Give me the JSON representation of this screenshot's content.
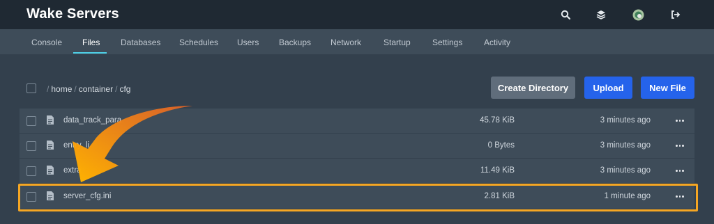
{
  "app": {
    "title": "Wake Servers"
  },
  "topbar": {
    "icons": [
      "search-icon",
      "layers-icon",
      "avatar",
      "logout-icon"
    ]
  },
  "nav": {
    "tabs": [
      {
        "label": "Console"
      },
      {
        "label": "Files"
      },
      {
        "label": "Databases"
      },
      {
        "label": "Schedules"
      },
      {
        "label": "Users"
      },
      {
        "label": "Backups"
      },
      {
        "label": "Network"
      },
      {
        "label": "Startup"
      },
      {
        "label": "Settings"
      },
      {
        "label": "Activity"
      }
    ],
    "active_tab": "Files"
  },
  "breadcrumb": {
    "root": "/",
    "segments": [
      "home",
      "container",
      "cfg"
    ],
    "separator": "/"
  },
  "actions": {
    "create_directory": "Create Directory",
    "upload": "Upload",
    "new_file": "New File"
  },
  "files": [
    {
      "name": "data_track_para",
      "size": "45.78 KiB",
      "modified": "3 minutes ago"
    },
    {
      "name": "entry_li",
      "size": "0 Bytes",
      "modified": "3 minutes ago"
    },
    {
      "name": "extra",
      "size": "11.49 KiB",
      "modified": "3 minutes ago"
    },
    {
      "name": "server_cfg.ini",
      "size": "2.81 KiB",
      "modified": "1 minute ago"
    }
  ],
  "annotation": {
    "arrow_color": "#f7941d",
    "highlight_color": "#f5a623",
    "highlighted_file": "server_cfg.ini"
  },
  "colors": {
    "topbar_bg": "#1f2933",
    "nav_bg": "#3e4c59",
    "page_bg": "#33404d",
    "accent": "#4fd1e8",
    "primary_button": "#2563eb",
    "secondary_button": "#606d7b"
  }
}
